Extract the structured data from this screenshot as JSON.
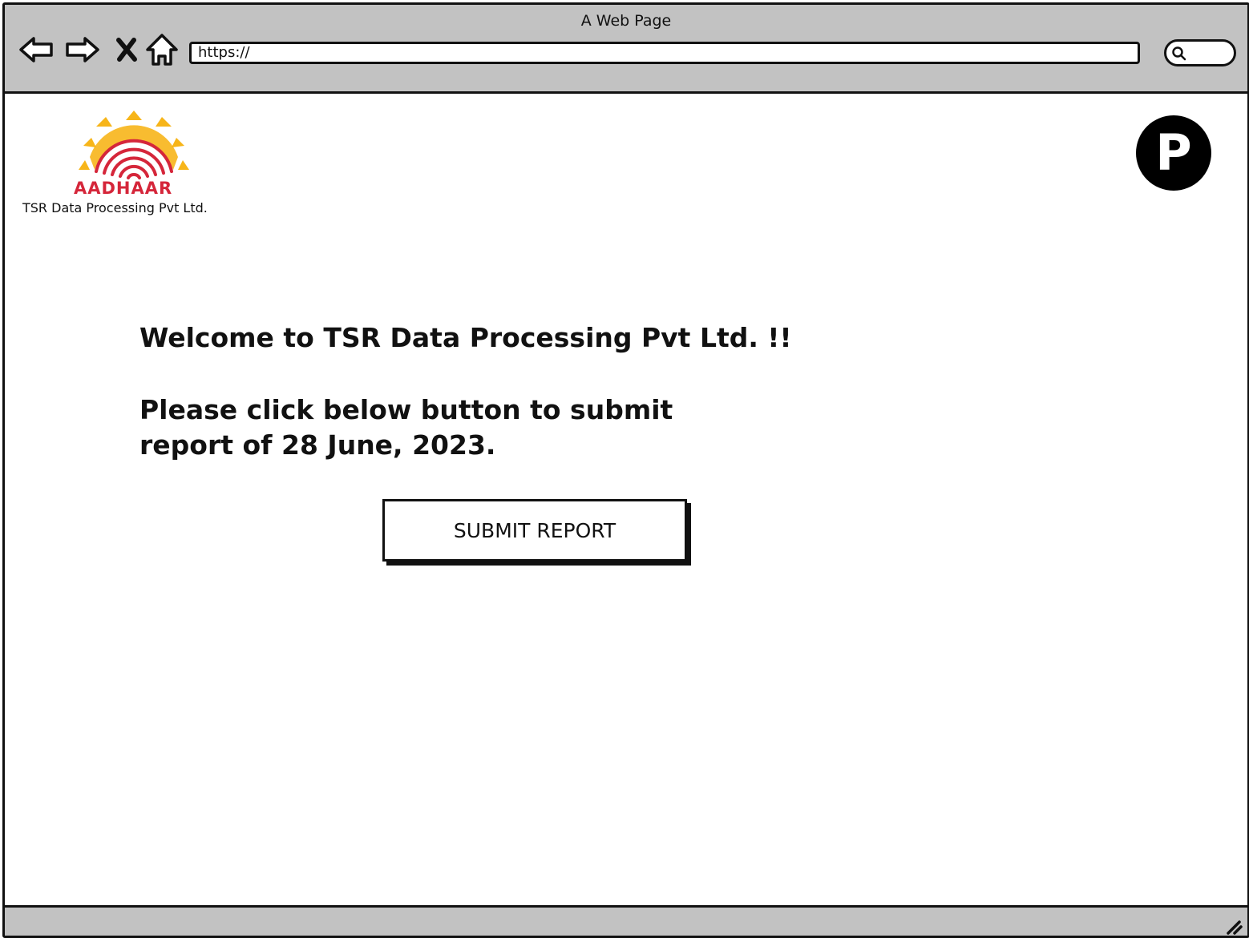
{
  "browser": {
    "title": "A Web Page",
    "url": "https://",
    "icons": [
      "back-arrow-icon",
      "forward-arrow-icon",
      "stop-icon",
      "home-icon",
      "search-icon",
      "resize-grip-icon"
    ]
  },
  "header": {
    "logo_text": "AADHAAR",
    "company_name": "TSR Data Processing Pvt Ltd.",
    "avatar_letter": "P"
  },
  "main": {
    "welcome": "Welcome to TSR Data Processing Pvt Ltd. !!",
    "instruction": "Please click below button to submit report of 28 June, 2023.",
    "submit_label": "SUBMIT REPORT"
  },
  "colors": {
    "chrome_gray": "#c2c2c2",
    "logo_red": "#d5263a",
    "logo_yellow": "#f7b519",
    "avatar_bg": "#000000"
  }
}
